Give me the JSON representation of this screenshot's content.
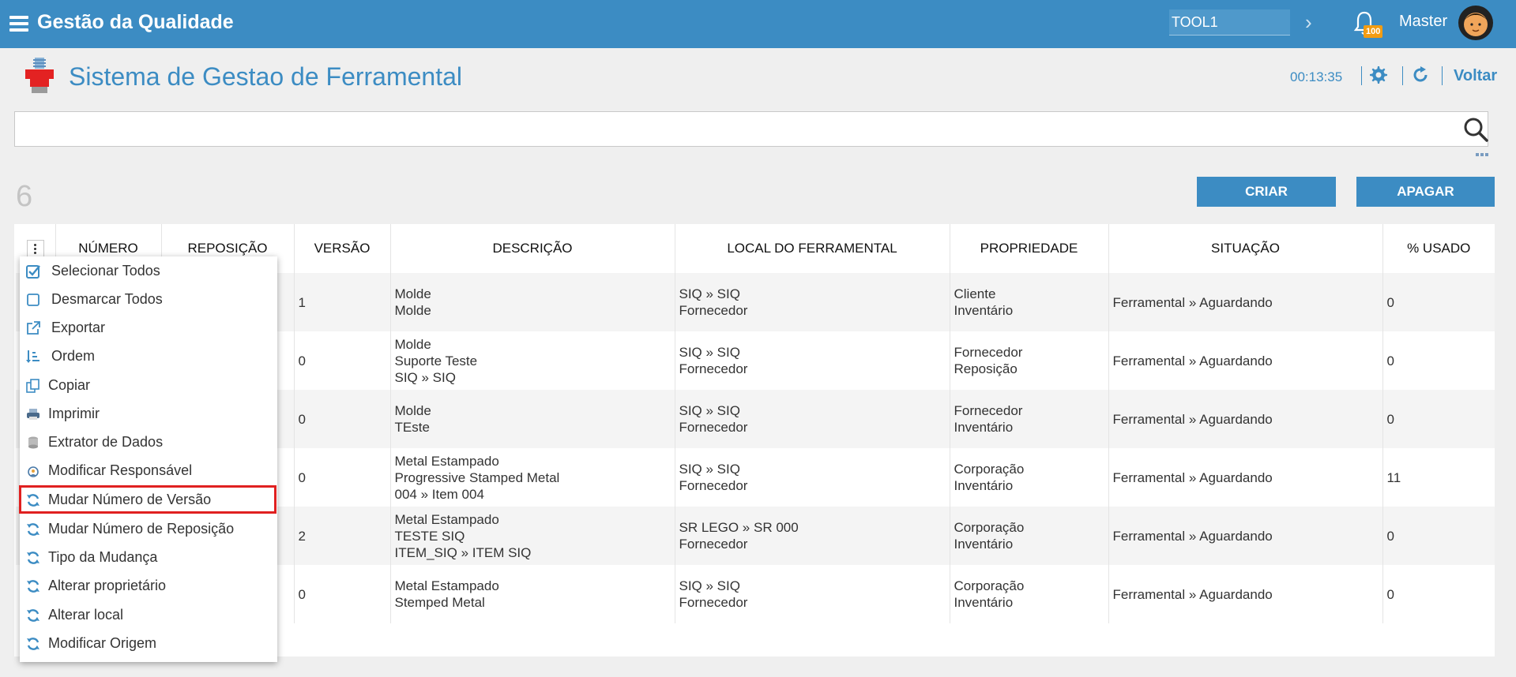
{
  "topbar": {
    "app_title": "Gestão da Qualidade",
    "context_value": "TOOL1",
    "notification_count": "100",
    "username": "Master"
  },
  "header": {
    "page_title": "Sistema de Gestao de Ferramental",
    "timer": "00:13:35",
    "back_label": "Voltar"
  },
  "search": {
    "value": "",
    "placeholder": ""
  },
  "toolbar": {
    "record_count": "6",
    "create_label": "CRIAR",
    "delete_label": "APAGAR"
  },
  "table": {
    "columns": [
      "NÚMERO",
      "REPOSIÇÃO",
      "VERSÃO",
      "DESCRIÇÃO",
      "LOCAL DO FERRAMENTAL",
      "PROPRIEDADE",
      "SITUAÇÃO",
      "% USADO"
    ],
    "rows": [
      {
        "versao": "1",
        "descricao": [
          "Molde",
          "Molde",
          ""
        ],
        "local": [
          "SIQ » SIQ",
          "Fornecedor"
        ],
        "propriedade": [
          "Cliente",
          "Inventário"
        ],
        "situacao": "Ferramental » Aguardando",
        "usado": "0"
      },
      {
        "versao": "0",
        "descricao": [
          "Molde",
          "Suporte Teste",
          "SIQ » SIQ"
        ],
        "local": [
          "SIQ » SIQ",
          "Fornecedor"
        ],
        "propriedade": [
          "Fornecedor",
          "Reposição"
        ],
        "situacao": "Ferramental » Aguardando",
        "usado": "0"
      },
      {
        "versao": "0",
        "descricao": [
          "Molde",
          "TEste",
          ""
        ],
        "local": [
          "SIQ » SIQ",
          "Fornecedor"
        ],
        "propriedade": [
          "Fornecedor",
          "Inventário"
        ],
        "situacao": "Ferramental » Aguardando",
        "usado": "0"
      },
      {
        "versao": "0",
        "descricao": [
          "Metal Estampado",
          "Progressive Stamped Metal",
          "004 » Item 004"
        ],
        "local": [
          "SIQ » SIQ",
          "Fornecedor"
        ],
        "propriedade": [
          "Corporação",
          "Inventário"
        ],
        "situacao": "Ferramental » Aguardando",
        "usado": "11"
      },
      {
        "versao": "2",
        "descricao": [
          "Metal Estampado",
          "TESTE SIQ",
          "ITEM_SIQ » ITEM SIQ"
        ],
        "local": [
          "SR LEGO » SR 000",
          "Fornecedor"
        ],
        "propriedade": [
          "Corporação",
          "Inventário"
        ],
        "situacao": "Ferramental » Aguardando",
        "usado": "0"
      },
      {
        "versao": "0",
        "descricao": [
          "Metal Estampado",
          "Stemped Metal",
          ""
        ],
        "local": [
          "SIQ » SIQ",
          "Fornecedor"
        ],
        "propriedade": [
          "Corporação",
          "Inventário"
        ],
        "situacao": "Ferramental » Aguardando",
        "usado": "0"
      }
    ]
  },
  "menu": {
    "items": [
      {
        "label": "Selecionar Todos",
        "icon": "check-square-icon"
      },
      {
        "label": "Desmarcar Todos",
        "icon": "square-icon"
      },
      {
        "label": "Exportar",
        "icon": "export-icon"
      },
      {
        "label": "Ordem",
        "icon": "sort-icon"
      },
      {
        "label": "Copiar",
        "icon": "copy-icon"
      },
      {
        "label": "Imprimir",
        "icon": "printer-icon"
      },
      {
        "label": "Extrator de Dados",
        "icon": "database-icon"
      },
      {
        "label": "Modificar Responsável",
        "icon": "user-edit-icon"
      },
      {
        "label": "Mudar Número de Versão",
        "icon": "refresh-icon"
      },
      {
        "label": "Mudar Número de Reposição",
        "icon": "refresh-icon"
      },
      {
        "label": "Tipo da Mudança",
        "icon": "refresh-icon"
      },
      {
        "label": "Alterar proprietário",
        "icon": "refresh-icon"
      },
      {
        "label": "Alterar local",
        "icon": "refresh-icon"
      },
      {
        "label": "Modificar Origem",
        "icon": "refresh-icon"
      }
    ],
    "highlighted": "Mudar Número de Versão"
  },
  "colors": {
    "primary": "#3c8cc3",
    "badge": "#f39c12",
    "highlight_border": "#e02020"
  }
}
